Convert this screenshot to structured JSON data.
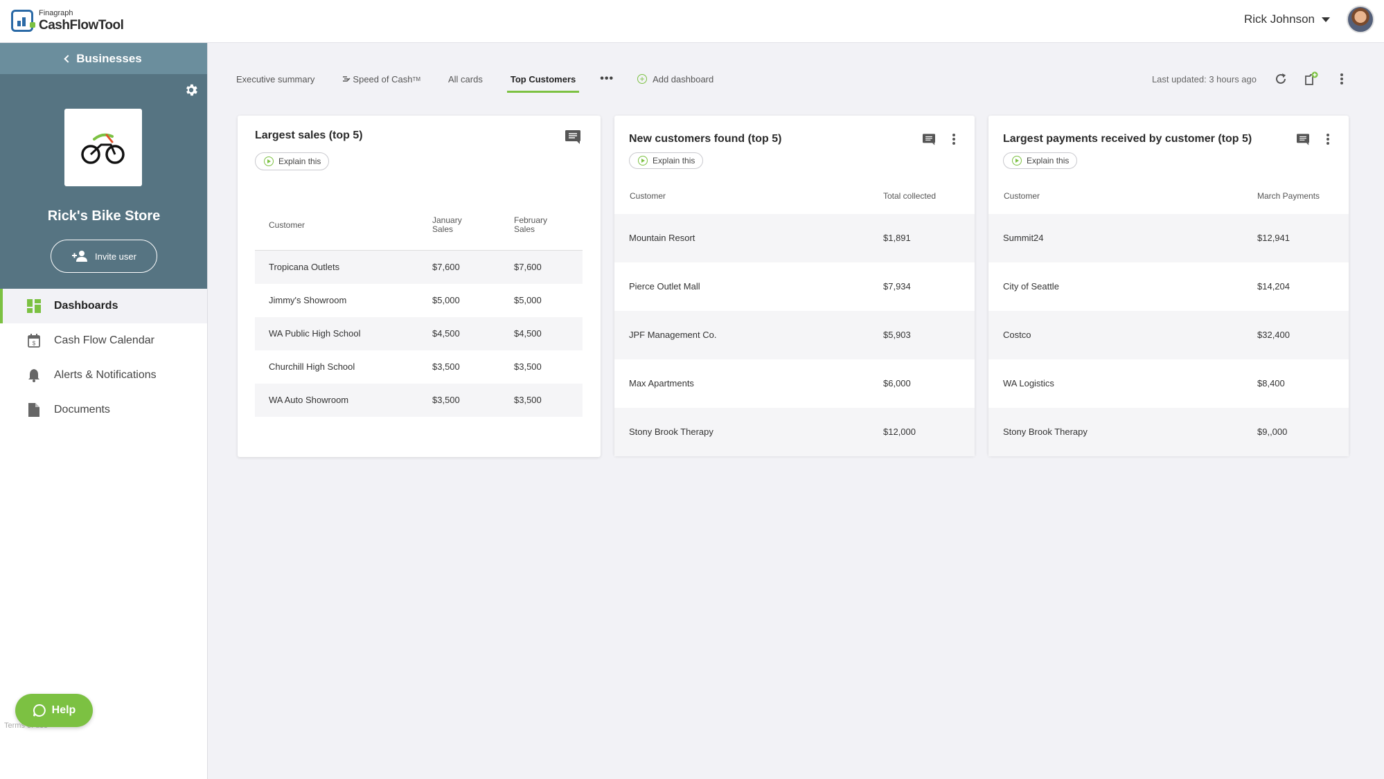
{
  "app": {
    "brand_small": "Finagraph",
    "brand_name": "CashFlowTool",
    "user_name": "Rick Johnson"
  },
  "sidebar": {
    "back_label": "Businesses",
    "business_name": "Rick's Bike Store",
    "invite_label": "Invite user",
    "nav": [
      {
        "label": "Dashboards",
        "icon": "dashboard-icon",
        "active": true
      },
      {
        "label": "Cash Flow Calendar",
        "icon": "calendar-icon"
      },
      {
        "label": "Alerts & Notifications",
        "icon": "bell-icon"
      },
      {
        "label": "Documents",
        "icon": "document-icon"
      }
    ],
    "help_label": "Help",
    "terms_label": "Terms of use"
  },
  "tabs": {
    "items": [
      "Executive summary",
      "Speed of Cash",
      "All cards",
      "Top Customers"
    ],
    "speed_tm": "TM",
    "add_label": "Add dashboard",
    "last_updated": "Last updated: 3 hours ago"
  },
  "cards": {
    "sales": {
      "title": "Largest sales (top 5)",
      "explain": "Explain this",
      "headers": [
        "Customer",
        "January Sales",
        "February Sales"
      ],
      "rows": [
        [
          "Tropicana Outlets",
          "$7,600",
          "$7,600"
        ],
        [
          "Jimmy's Showroom",
          "$5,000",
          "$5,000"
        ],
        [
          "WA Public High School",
          "$4,500",
          "$4,500"
        ],
        [
          "Churchill High School",
          "$3,500",
          "$3,500"
        ],
        [
          "WA Auto Showroom",
          "$3,500",
          "$3,500"
        ]
      ]
    },
    "new_customers": {
      "title": "New customers found (top 5)",
      "explain": "Explain this",
      "headers": [
        "Customer",
        "Total collected"
      ],
      "rows": [
        [
          "Mountain Resort",
          "$1,891"
        ],
        [
          "Pierce Outlet Mall",
          "$7,934"
        ],
        [
          "JPF Management Co.",
          "$5,903"
        ],
        [
          "Max Apartments",
          "$6,000"
        ],
        [
          "Stony Brook Therapy",
          "$12,000"
        ]
      ]
    },
    "payments": {
      "title": "Largest payments received by customer (top 5)",
      "explain": "Explain this",
      "headers": [
        "Customer",
        "March Payments"
      ],
      "rows": [
        [
          "Summit24",
          "$12,941"
        ],
        [
          "City of Seattle",
          "$14,204"
        ],
        [
          "Costco",
          "$32,400"
        ],
        [
          "WA Logistics",
          "$8,400"
        ],
        [
          "Stony Brook Therapy",
          "$9,,000"
        ]
      ]
    }
  }
}
